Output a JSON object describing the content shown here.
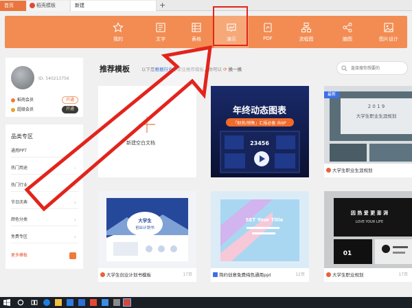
{
  "tabs": {
    "home": "首页",
    "wps": "稻壳模板",
    "new": "新建"
  },
  "categories": [
    {
      "label": "我的",
      "icon": "star-icon"
    },
    {
      "label": "文字",
      "icon": "writer-icon"
    },
    {
      "label": "表格",
      "icon": "spreadsheet-icon"
    },
    {
      "label": "演示",
      "icon": "presentation-icon"
    },
    {
      "label": "PDF",
      "icon": "pdf-icon"
    },
    {
      "label": "流程图",
      "icon": "flowchart-icon"
    },
    {
      "label": "脑图",
      "icon": "mindmap-icon"
    },
    {
      "label": "图片设计",
      "icon": "image-design-icon"
    }
  ],
  "user": {
    "id": "ID: 540213756",
    "member1": "稻壳会员",
    "member1_btn": "开通",
    "member2": "超级会员",
    "member2_btn": "开通"
  },
  "nav": {
    "title": "品类专区",
    "items": [
      "通用PPT",
      "热门用途",
      "热门行业",
      "节日庆典",
      "颜色分类",
      "免费专区"
    ],
    "more": "更多模板"
  },
  "main": {
    "title": "推荐模板",
    "hint_prefix": "以下是",
    "hint_link": "根据行业",
    "hint_suffix": "等职业推荐模板，你可以",
    "hint_action": "换一换",
    "search_placeholder": "直接搜你想要的"
  },
  "blank": {
    "label": "新建空白文档"
  },
  "cards": {
    "c2": {
      "title_main": "年终动态图表",
      "subtitle": "「财务/销售」汇报必备  共6P",
      "number": "23456"
    },
    "c3": {
      "badge": "最新",
      "year": "2 0 1 9",
      "inner_title": "大学生职业生涯规划",
      "caption": "大学生职业生涯规划"
    },
    "c4": {
      "inner_title": "大学生",
      "inner_sub": "创业计划书",
      "caption": "大学生创业计划书模板",
      "pages": "17页"
    },
    "c5": {
      "inner_title": "SET Your Title",
      "caption": "简约创意免费纯色通用ppt",
      "pages": "12页"
    },
    "c6": {
      "inner_title": "因 热 爱  更 澎 湃",
      "inner_sub": "LOVE YOUR LIFE",
      "inner_num": "01",
      "caption": "大学生职业规划",
      "pages": "17页"
    }
  },
  "colors": {
    "accent": "#f28c52",
    "highlight": "#e2241c"
  }
}
